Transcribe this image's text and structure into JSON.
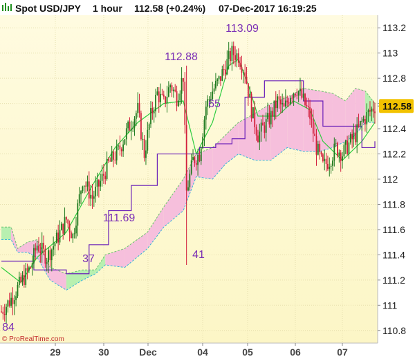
{
  "header": {
    "instrument": "Spot USD/JPY",
    "timeframe": "1 hour",
    "last_price": "112.58",
    "change": "(+0.24%)",
    "timestamp": "07-Dec-2017 16:19:25",
    "icon": "price-bars-icon"
  },
  "footer": {
    "watermark": "© ProRealTime.com"
  },
  "colors": {
    "background": "#fdf9cf",
    "bull_candle": "#1f7a1f",
    "bear_candle": "#d21f3c",
    "tenkan": "#2ecc40",
    "kijun": "#6a1fb8",
    "span_a": "#6cc070",
    "span_b": "#36b3d9",
    "cloud_bull": "#b8f0b0",
    "cloud_bear": "#f6bfdc",
    "annotation": "#7b2fb5",
    "last_price_tag": "#f2c200"
  },
  "chart_data": {
    "type": "candlestick",
    "title": "Spot USD/JPY 1 hour",
    "ylim": [
      110.7,
      113.3
    ],
    "yticks": [
      "113.2",
      "113",
      "112.8",
      "112.6",
      "112.4",
      "112.2",
      "112",
      "111.8",
      "111.6",
      "111.4",
      "111.2",
      "111",
      "110.8"
    ],
    "xticks": [
      "29",
      "30",
      "Dec",
      "04",
      "05",
      "06",
      "07"
    ],
    "last_price": 112.58,
    "annotations": [
      {
        "text": "113.09",
        "x": "04",
        "price": 113.09
      },
      {
        "text": "112.88",
        "x": "Dec",
        "price": 112.88
      },
      {
        "text": "111.69",
        "x": "30",
        "price": 111.69
      },
      {
        "text": "65",
        "x": "04",
        "price": 112.55
      },
      {
        "text": "41",
        "x": "04",
        "price": 111.35
      },
      {
        "text": "37",
        "x": "30",
        "price": 111.3
      },
      {
        "text": "84",
        "x": "29",
        "price": 110.78
      }
    ],
    "path_points": [
      [
        0,
        110.95
      ],
      [
        6,
        111.05
      ],
      [
        12,
        111.18
      ],
      [
        18,
        111.3
      ],
      [
        22,
        111.48
      ],
      [
        28,
        111.38
      ],
      [
        34,
        111.52
      ],
      [
        40,
        111.68
      ],
      [
        44,
        111.55
      ],
      [
        50,
        112.0
      ],
      [
        56,
        111.85
      ],
      [
        60,
        111.95
      ],
      [
        66,
        112.12
      ],
      [
        72,
        112.22
      ],
      [
        78,
        112.4
      ],
      [
        84,
        112.55
      ],
      [
        88,
        112.2
      ],
      [
        92,
        112.5
      ],
      [
        96,
        112.68
      ],
      [
        100,
        112.6
      ],
      [
        104,
        112.75
      ],
      [
        108,
        112.65
      ],
      [
        112,
        112.82
      ],
      [
        114,
        111.9
      ],
      [
        118,
        112.15
      ],
      [
        122,
        112.2
      ],
      [
        126,
        112.58
      ],
      [
        130,
        112.7
      ],
      [
        134,
        112.78
      ],
      [
        138,
        112.9
      ],
      [
        142,
        113.0
      ],
      [
        146,
        112.98
      ],
      [
        150,
        112.85
      ],
      [
        154,
        112.55
      ],
      [
        158,
        112.35
      ],
      [
        162,
        112.42
      ],
      [
        166,
        112.5
      ],
      [
        170,
        112.62
      ],
      [
        174,
        112.55
      ],
      [
        178,
        112.68
      ],
      [
        182,
        112.72
      ],
      [
        186,
        112.62
      ],
      [
        190,
        112.5
      ],
      [
        194,
        112.25
      ],
      [
        198,
        112.1
      ],
      [
        202,
        112.15
      ],
      [
        206,
        112.25
      ],
      [
        210,
        112.2
      ],
      [
        214,
        112.28
      ],
      [
        218,
        112.35
      ],
      [
        222,
        112.45
      ],
      [
        226,
        112.52
      ],
      [
        230,
        112.58
      ]
    ],
    "tenkan_points": [
      [
        0,
        111.3
      ],
      [
        12,
        111.18
      ],
      [
        22,
        111.38
      ],
      [
        40,
        111.58
      ],
      [
        56,
        111.95
      ],
      [
        70,
        112.25
      ],
      [
        84,
        112.45
      ],
      [
        100,
        112.6
      ],
      [
        112,
        112.62
      ],
      [
        120,
        112.2
      ],
      [
        130,
        112.45
      ],
      [
        140,
        112.9
      ],
      [
        146,
        112.95
      ],
      [
        152,
        112.75
      ],
      [
        158,
        112.5
      ],
      [
        170,
        112.5
      ],
      [
        180,
        112.62
      ],
      [
        190,
        112.55
      ],
      [
        198,
        112.3
      ],
      [
        210,
        112.15
      ],
      [
        222,
        112.3
      ],
      [
        230,
        112.45
      ]
    ],
    "kijun_points": [
      [
        0,
        111.35
      ],
      [
        20,
        111.28
      ],
      [
        40,
        111.25
      ],
      [
        54,
        111.48
      ],
      [
        66,
        111.75
      ],
      [
        80,
        111.95
      ],
      [
        96,
        112.2
      ],
      [
        114,
        112.2
      ],
      [
        122,
        112.25
      ],
      [
        132,
        112.28
      ],
      [
        142,
        112.32
      ],
      [
        150,
        112.65
      ],
      [
        162,
        112.78
      ],
      [
        180,
        112.78
      ],
      [
        186,
        112.62
      ],
      [
        198,
        112.42
      ],
      [
        214,
        112.42
      ],
      [
        222,
        112.25
      ],
      [
        230,
        112.3
      ]
    ],
    "cloud_points": [
      [
        0,
        111.62,
        111.52
      ],
      [
        6,
        111.62,
        111.52
      ],
      [
        10,
        111.45,
        111.42
      ],
      [
        16,
        111.5,
        111.42
      ],
      [
        22,
        111.52,
        111.38
      ],
      [
        30,
        111.3,
        111.2
      ],
      [
        40,
        111.25,
        111.12
      ],
      [
        50,
        111.28,
        111.2
      ],
      [
        58,
        111.28,
        111.25
      ],
      [
        64,
        111.4,
        111.32
      ],
      [
        76,
        111.45,
        111.3
      ],
      [
        90,
        111.58,
        111.45
      ],
      [
        100,
        111.78,
        111.62
      ],
      [
        112,
        112.0,
        111.75
      ],
      [
        120,
        112.2,
        112.02
      ],
      [
        130,
        112.25,
        112.0
      ],
      [
        138,
        112.35,
        112.12
      ],
      [
        146,
        112.45,
        112.2
      ],
      [
        156,
        112.52,
        112.15
      ],
      [
        166,
        112.6,
        112.15
      ],
      [
        176,
        112.65,
        112.25
      ],
      [
        186,
        112.72,
        112.22
      ],
      [
        196,
        112.7,
        112.22
      ],
      [
        204,
        112.68,
        112.25
      ],
      [
        212,
        112.62,
        112.3
      ],
      [
        218,
        112.72,
        112.35
      ],
      [
        224,
        112.7,
        112.45
      ],
      [
        230,
        112.6,
        112.45
      ]
    ]
  }
}
